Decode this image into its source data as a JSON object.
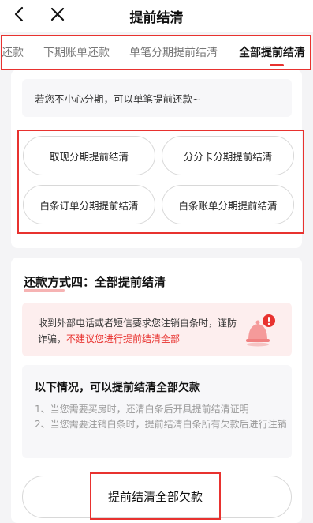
{
  "header": {
    "title": "提前结清",
    "back_icon": "chevron-left-icon",
    "close_icon": "close-icon"
  },
  "tabs": [
    {
      "label": "还款",
      "active": false
    },
    {
      "label": "下期账单还款",
      "active": false
    },
    {
      "label": "单笔分期提前结清",
      "active": false
    },
    {
      "label": "全部提前结清",
      "active": true
    }
  ],
  "hint": {
    "text": "若您不小心分期，可以单笔提前还款~"
  },
  "options": [
    {
      "label": "取现分期提前结清"
    },
    {
      "label": "分分卡分期提前结清"
    },
    {
      "label": "白条订单分期提前结清"
    },
    {
      "label": "白条账单分期提前结清"
    }
  ],
  "method": {
    "title": "还款方式四：全部提前结清"
  },
  "warning": {
    "text": "收到外部电话或者短信要求您注销白条时，谨防诈骗，",
    "highlight": "不建议您进行提前结清全部",
    "icon": "alert-bell-icon"
  },
  "cases": {
    "title": "以下情况，可以提前结清全部欠款",
    "items": [
      "1、当您需要买房时，还清白条后开具提前结清证明",
      "2、当您需要注销白条时，提前结清白条所有欠款后进行注销"
    ]
  },
  "payoff_button": {
    "label": "提前结清全部欠款"
  },
  "colors": {
    "accent_red": "#e8322f",
    "warning_bg": "#fdeeee",
    "page_bg": "#f4f4f6"
  }
}
